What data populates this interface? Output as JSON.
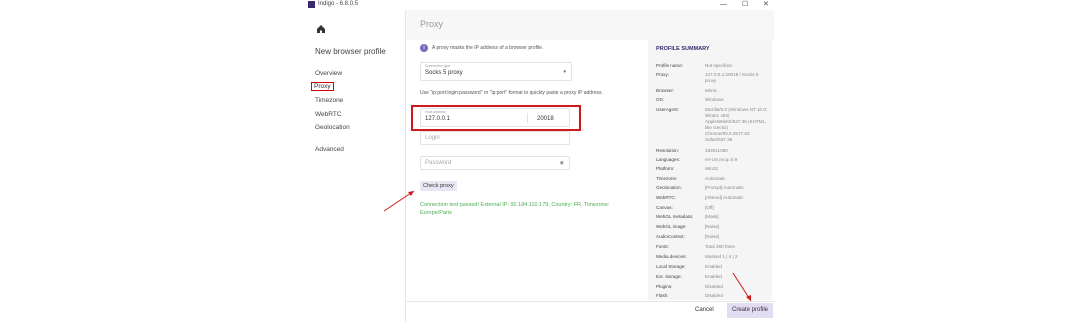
{
  "window": {
    "title": "Indigo - 6.8.0.5",
    "minimize_glyph": "—",
    "maximize_glyph": "☐",
    "close_glyph": "✕"
  },
  "sidebar": {
    "title": "New browser profile",
    "items": [
      {
        "label": "Overview"
      },
      {
        "label": "Proxy"
      },
      {
        "label": "Timezone"
      },
      {
        "label": "WebRTC"
      },
      {
        "label": "Geolocation"
      },
      {
        "label": "Advanced"
      }
    ]
  },
  "proxy": {
    "header": "Proxy",
    "info": "A proxy masks the IP address of a browser profile.",
    "connection_type_label": "Connection type",
    "connection_type_value": "Socks 5 proxy",
    "hint": "Use \"ip:port:login:password\" or \"ip:port\" format to quickly paste a proxy IP address.",
    "host_label": "Host address",
    "host_value": "127.0.0.1",
    "port_value": "20018",
    "login_placeholder": "Login",
    "password_placeholder": "Password",
    "check_button": "Check proxy",
    "result": "Connection test passed! External IP: 92.184.110.179, Country: FR, Timezone: Europe/Paris"
  },
  "summary": {
    "title": "PROFILE SUMMARY",
    "rows": [
      {
        "k": "Profile name:",
        "v": "Not specified"
      },
      {
        "k": "Proxy:",
        "v": "127.0.0.1:20018 / Socks 5 proxy"
      },
      {
        "k": "Browser:",
        "v": "Mimic"
      },
      {
        "k": "OS:",
        "v": "Windows"
      },
      {
        "k": "UserAgent:",
        "v": "Mozilla/5.0 (Windows NT 10.0; Win64; x64) AppleWebKit/537.36 (KHTML, like Gecko) Chrome/93.0.4577.63 Safari/537.36"
      },
      {
        "k": "Resolution:",
        "v": "1920x1080"
      },
      {
        "k": "Languages:",
        "v": "en-US,en;q=0.9"
      },
      {
        "k": "Platform:",
        "v": "Win32"
      },
      {
        "k": "Timezone:",
        "v": "Automatic"
      },
      {
        "k": "Geolocation:",
        "v": "[Prompt] Automatic"
      },
      {
        "k": "WebRTC:",
        "v": "[Altered] Automatic"
      },
      {
        "k": "Canvas:",
        "v": "[Off]"
      },
      {
        "k": "WebGL metadata:",
        "v": "[Mask]"
      },
      {
        "k": "WebGL image:",
        "v": "[Noise]"
      },
      {
        "k": "AudioContext:",
        "v": "[Noise]"
      },
      {
        "k": "Fonts:",
        "v": "Total 260 fonts"
      },
      {
        "k": "Media devices:",
        "v": "Masked 1 | 4 | 2"
      },
      {
        "k": "Local Storage:",
        "v": "Enabled"
      },
      {
        "k": "Ext. storage:",
        "v": "Enabled"
      },
      {
        "k": "Plugins:",
        "v": "Disabled"
      },
      {
        "k": "Flash:",
        "v": "Disabled"
      }
    ]
  },
  "footer": {
    "cancel": "Cancel",
    "create": "Create profile"
  },
  "colors": {
    "accent": "#3b2a6e",
    "highlight": "#d0191b",
    "success": "#4caf50",
    "button_bg": "#e3ddf3"
  }
}
